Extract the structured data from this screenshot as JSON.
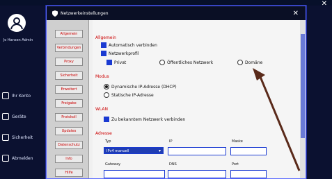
{
  "background": {
    "user_name": "Jo Hansen\n Admin",
    "sidebar_items": [
      "Ihr Konto",
      "Geräte",
      "Sicherheit",
      "Abmelden"
    ]
  },
  "dialog": {
    "title": "Netzwerkeinstellungen",
    "close_glyph": "✕",
    "nav_items": [
      {
        "label": "Allgemein",
        "active": false
      },
      {
        "label": "Verbindungen",
        "active": false
      },
      {
        "label": "Proxy",
        "active": false
      },
      {
        "label": "Sicherheit",
        "active": false
      },
      {
        "label": "Erweitert",
        "active": false
      },
      {
        "label": "Freigabe",
        "active": false
      },
      {
        "label": "Protokoll",
        "active": false
      },
      {
        "label": "Updates",
        "active": false
      },
      {
        "label": "Datenschutz",
        "active": false
      },
      {
        "label": "Info",
        "active": false
      },
      {
        "label": "Hilfe",
        "active": false
      }
    ],
    "sections": {
      "general": {
        "title": "Allgemein",
        "check1": "Automatisch verbinden",
        "check2_label": "Netzwerkprofil",
        "radio_a": "Privat",
        "radio_b": "Öffentliches Netzwerk",
        "radio_c": "Domäne"
      },
      "mode": {
        "title": "Modus",
        "opt1": "Dynamische IP-Adresse (DHCP)",
        "opt2": "Statische IP-Adresse"
      },
      "wifi": {
        "title": "WLAN",
        "check": "Zu bekanntem Netzwerk verbinden"
      },
      "address": {
        "title": "Adresse",
        "label_type": "Typ",
        "label_ip": "IP",
        "label_mask": "Maske",
        "select_value": "IPv4 manuell",
        "label_gateway": "Gateway",
        "label_dns": "DNS",
        "label_port": "Port"
      }
    }
  },
  "colors": {
    "accent": "#1a3ad2",
    "titlebar": "#0a0f25",
    "arrow": "#5a2a1a"
  }
}
